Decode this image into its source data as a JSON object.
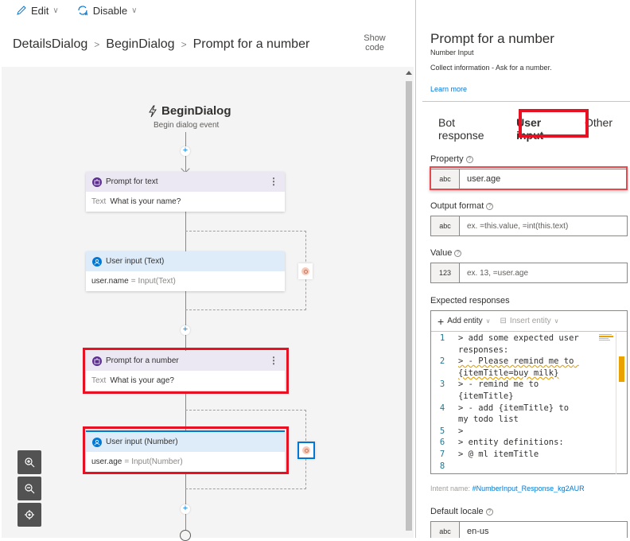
{
  "toolbar": {
    "edit_label": "Edit",
    "disable_label": "Disable"
  },
  "breadcrumb": {
    "items": [
      "DetailsDialog",
      "BeginDialog",
      "Prompt for a number"
    ],
    "separator": ">"
  },
  "show_code": {
    "line1": "Show",
    "line2": "code"
  },
  "canvas": {
    "trigger_title": "BeginDialog",
    "trigger_subtitle": "Begin dialog event",
    "nodes": [
      {
        "header": "Prompt for text",
        "body_label": "Text",
        "body_value": "What is your name?",
        "kind": "prompt"
      },
      {
        "header": "User input (Text)",
        "body_var": "user.name",
        "body_eq": "=",
        "body_value": "Input(Text)",
        "kind": "input"
      },
      {
        "header": "Prompt for a number",
        "body_label": "Text",
        "body_value": "What is your age?",
        "kind": "prompt"
      },
      {
        "header": "User input (Number)",
        "body_var": "user.age",
        "body_eq": "=",
        "body_value": "Input(Number)",
        "kind": "input"
      }
    ],
    "plus_symbol": "+",
    "more_symbol": "⋮"
  },
  "panel": {
    "title": "Prompt for a number",
    "type": "Number Input",
    "description": "Collect information - Ask for a number.",
    "learn_more": "Learn more",
    "tabs": [
      "Bot response",
      "User input",
      "Other"
    ],
    "active_tab": "User input",
    "fields": {
      "property": {
        "label": "Property",
        "prefix": "abc",
        "value": "user.age"
      },
      "output_format": {
        "label": "Output format",
        "prefix": "abc",
        "placeholder": "ex. =this.value, =int(this.text)"
      },
      "value": {
        "label": "Value",
        "prefix": "123",
        "placeholder": "ex. 13, =user.age"
      },
      "default_locale": {
        "label": "Default locale",
        "prefix": "abc",
        "value": "en-us"
      }
    },
    "help_symbol": "?",
    "expected_responses": {
      "label": "Expected responses",
      "add_entity": "Add entity",
      "insert_entity": "Insert entity",
      "lines": [
        {
          "n": "1",
          "text": "> add some expected user responses:"
        },
        {
          "n": "2",
          "text": "> - Please remind me to {itemTitle=buy milk}"
        },
        {
          "n": "3",
          "text": "> - remind me to {itemTitle}"
        },
        {
          "n": "4",
          "text": "> - add {itemTitle} to my todo list"
        },
        {
          "n": "5",
          "text": ">"
        },
        {
          "n": "6",
          "text": "> entity definitions:"
        },
        {
          "n": "7",
          "text": "> @ ml itemTitle"
        },
        {
          "n": "8",
          "text": ""
        }
      ]
    },
    "intent_label": "Intent name:",
    "intent_value": "#NumberInput_Response_kg2AUR"
  },
  "colors": {
    "accent": "#0078d4",
    "highlight": "#e81123",
    "prompt_header": "#ebe8f3",
    "input_header": "#deecf9"
  }
}
